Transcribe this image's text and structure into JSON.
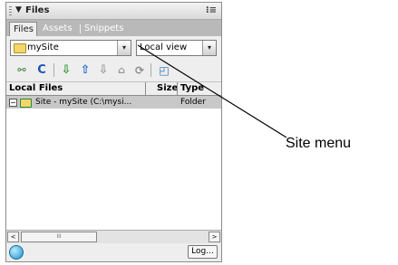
{
  "panel": {
    "title": "Files",
    "title_arrow": "▼",
    "options_glyph": "⁝≡"
  },
  "tabs": [
    {
      "label": "Files",
      "active": true
    },
    {
      "label": "Assets",
      "active": false
    },
    {
      "label": "Snippets",
      "active": false
    }
  ],
  "site_select": {
    "value": "mySite"
  },
  "view_select": {
    "value": "Local view"
  },
  "dropdown_glyph": "▾",
  "toolbar": {
    "icons": [
      "connect-icon",
      "refresh-icon",
      "get-icon",
      "put-icon",
      "check-out-icon",
      "check-in-icon",
      "synchronize-icon",
      "expand-icon"
    ]
  },
  "columns": {
    "local_files": "Local Files",
    "size": "Size",
    "type": "Type"
  },
  "rows": [
    {
      "expander": "−",
      "name": "Site - mySite (C:\\mysi...",
      "size": "",
      "type": "Folder"
    }
  ],
  "status": {
    "log_label": "Log..."
  },
  "scrollbar": {
    "left": "<",
    "right": ">",
    "thumb": "III"
  },
  "callout": {
    "label": "Site menu"
  },
  "colors": {
    "panel_bg": "#d7d7d7",
    "tab_strip": "#b9b9b9",
    "row_selected": "#c8c8c8",
    "folder_yellow": "#f4d66b"
  }
}
